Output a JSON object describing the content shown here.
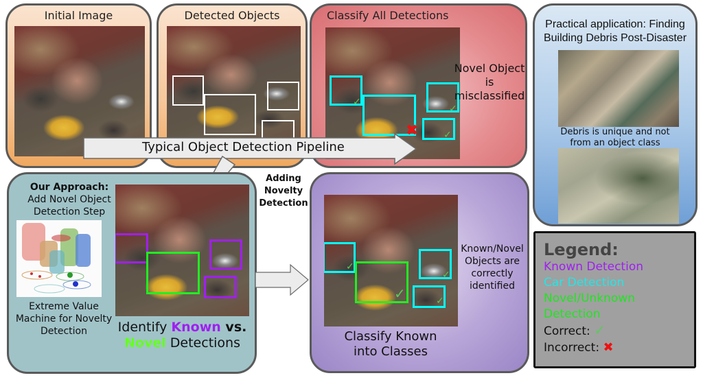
{
  "panels": {
    "initial": {
      "title": "Initial Image"
    },
    "detected": {
      "title": "Detected Objects"
    },
    "classify_all": {
      "title": "Classify All Detections",
      "note": [
        "Novel Object",
        "is",
        "misclassified"
      ]
    },
    "practical": {
      "title_lines": [
        "Practical application: Finding",
        "Building Debris Post-Disaster"
      ],
      "caption_lines": [
        "Debris is unique and not",
        "from an object class"
      ]
    },
    "approach": {
      "heading": "Our Approach:",
      "subtitle_lines": [
        "Add Novel Object",
        "Detection Step"
      ],
      "evm_caption_lines": [
        "Extreme Value",
        "Machine for Novelty",
        "Detection"
      ],
      "identify": {
        "prefix": "Identify ",
        "known": "Known",
        "vs": " vs.",
        "novel": "Novel",
        "suffix": " Detections"
      }
    },
    "classify_known": {
      "caption_lines": [
        "Classify Known",
        "into Classes"
      ],
      "note": [
        "Known/Novel",
        "Objects are",
        "correctly",
        "identified"
      ]
    }
  },
  "arrows": {
    "pipeline_label": "Typical Object Detection Pipeline",
    "novelty_label_lines": [
      "Adding",
      "Novelty",
      "Detection"
    ]
  },
  "legend": {
    "title": "Legend:",
    "items": [
      {
        "label": "Known Detection",
        "color": "#a020f0"
      },
      {
        "label": "Car Detection",
        "color": "#22e6e6"
      },
      {
        "label": "Novel/Unknown",
        "color": "#1ee61e"
      },
      {
        "label": "Detection",
        "color": "#1ee61e"
      }
    ],
    "correct_label": "Correct:",
    "incorrect_label": "Incorrect:"
  },
  "colors": {
    "known": "#a020f0",
    "car": "#00ffff",
    "novel": "#22ee22",
    "correct": "#5bc95b",
    "incorrect": "#ee1111"
  },
  "glyphs": {
    "check": "✓",
    "cross": "✖"
  }
}
